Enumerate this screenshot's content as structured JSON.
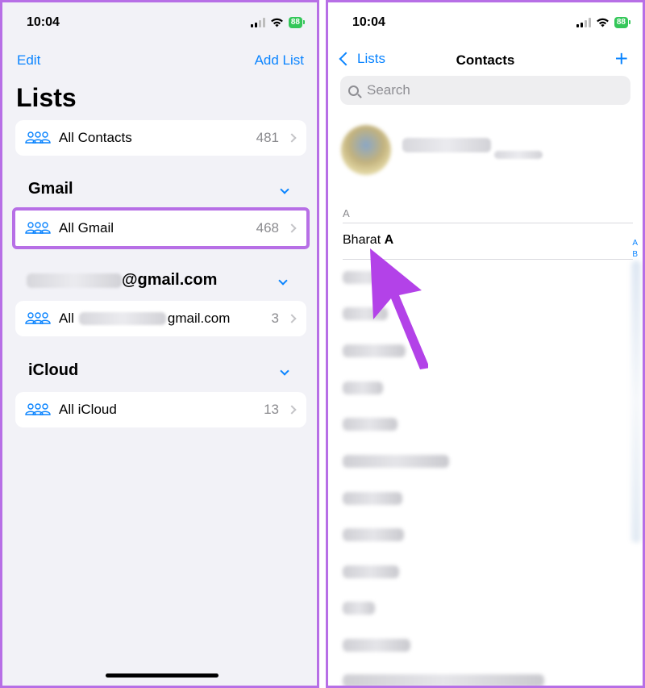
{
  "status": {
    "time": "10:04",
    "battery": "88"
  },
  "left": {
    "nav": {
      "edit": "Edit",
      "add": "Add List"
    },
    "title": "Lists",
    "all_contacts": {
      "label": "All Contacts",
      "count": "481"
    },
    "sections": [
      {
        "title": "Gmail",
        "item_label": "All Gmail",
        "count": "468"
      },
      {
        "title_suffix": "@gmail.com",
        "item_prefix": "All",
        "item_suffix": "gmail.com",
        "count": "3"
      },
      {
        "title": "iCloud",
        "item_label": "All iCloud",
        "count": "13"
      }
    ]
  },
  "right": {
    "nav": {
      "back": "Lists",
      "title": "Contacts"
    },
    "search_placeholder": "Search",
    "section_letter": "A",
    "first_contact": {
      "first": "Bharat",
      "last": "A"
    },
    "index_letters": [
      "A",
      "B"
    ]
  },
  "colors": {
    "accent": "#0a84ff",
    "highlight": "#b76fe6",
    "battery": "#34c759"
  },
  "icons": [
    "group-icon",
    "chevron-right-icon",
    "chevron-down-icon",
    "back-chevron-icon",
    "plus-icon",
    "search-icon",
    "wifi-icon",
    "cellular-icon",
    "battery-icon",
    "pointer-arrow-icon"
  ]
}
